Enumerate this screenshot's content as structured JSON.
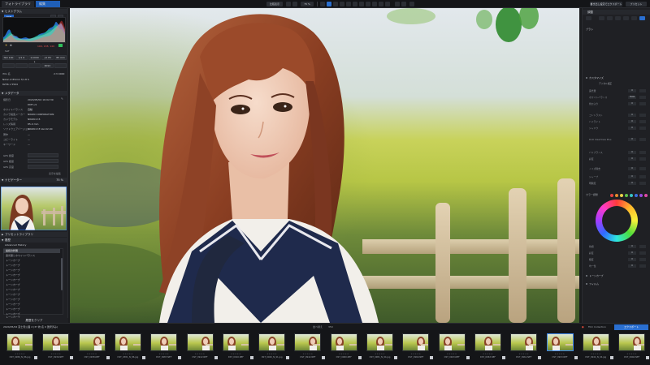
{
  "topbar": {
    "tab_library": "フォトライブラリ",
    "tab_edit": "編集",
    "compare_label": "比較表示",
    "zoom_label": "75 %",
    "export_label": "書き出し設定でエクスポート",
    "sync_label": "同期",
    "share_label": "プリセット"
  },
  "left": {
    "histogram_title": "ヒストグラム",
    "histo_badge": "RGB",
    "histo_values": "100, 138, 140",
    "camera_label": "SAT",
    "exif_boxes": [
      "ISO 100",
      "1/1 6",
      "1/1000 s",
      "+0 EV",
      "85 mm"
    ],
    "mode_label": "PASV",
    "lens_label": "Nikon Z 85mm f/1.8 S",
    "res_label": "8256 x 5504",
    "image_label": "IMG 名",
    "image_value": "2:3 0000",
    "metadata_title": "メタデータ",
    "meta_rows": [
      {
        "label": "撮影日",
        "value": "2024/05/02 16:02:39"
      },
      {
        "label": "",
        "value": "DMT+9"
      },
      {
        "label": "ホワイトバランス",
        "value": "自動"
      },
      {
        "label": "カメラ製造メーカー",
        "value": "NIKON CORPORATION"
      },
      {
        "label": "カメラモデル",
        "value": "NIKON Z 8"
      },
      {
        "label": "レンズ情報",
        "value": "85.0 mm"
      },
      {
        "label": "ソフトウェアバージョン",
        "value": "NIKON Z 8 Ver.02.00"
      },
      {
        "label": "著作",
        "value": "—"
      },
      {
        "label": "コピーライト",
        "value": "—"
      },
      {
        "label": "キーワード",
        "value": "—"
      },
      {
        "label": "GPS 緯度",
        "value": ""
      },
      {
        "label": "GPS 経度",
        "value": ""
      },
      {
        "label": "GPS 高度",
        "value": ""
      }
    ],
    "apply_label": "表示を編集",
    "navigator_title": "ナビゲーター",
    "nav_zoom": "75 %",
    "preset_title": "プリセットライブラリ",
    "history_title": "履歴",
    "history_subtitle": "Advanced History",
    "history_items": [
      "最初の状態",
      "露光量とホワイトバランス",
      "トーンカーブ",
      "トーンカーブ",
      "トーンカーブ",
      "トーンカーブ",
      "トーンカーブ",
      "トーンカーブ",
      "トーンカーブ",
      "トーンカーブ",
      "トーンカーブ",
      "トーンカーブ",
      "トーンカーブ",
      "トーンカーブ",
      "トーンカーブ"
    ],
    "footer_label": "履歴をクリア"
  },
  "right": {
    "header_label": "調整",
    "tool_label": "ブラシ",
    "section_title": "カスタマイズ",
    "section_sub": "デジタル補正",
    "rows": [
      {
        "label": "露光量",
        "value": "0"
      },
      {
        "label": "ホワイトバランス",
        "value": "5500"
      },
      {
        "label": "色かぶり",
        "value": "0"
      },
      {
        "label": "コントラスト",
        "value": "0"
      },
      {
        "label": "ハイライト",
        "value": "0"
      },
      {
        "label": "シャドウ",
        "value": "0"
      },
      {
        "label": "DxO ClearView Plus",
        "value": "0"
      },
      {
        "label": "バイブランス",
        "value": "0"
      },
      {
        "label": "彩度",
        "value": "0"
      },
      {
        "label": "ノイズ除去",
        "value": "0"
      },
      {
        "label": "シャープ",
        "value": "0"
      },
      {
        "label": "明瞭度",
        "value": "0"
      }
    ],
    "color_label": "カラー調整",
    "hsl_rows": [
      {
        "label": "色相",
        "value": "0"
      },
      {
        "label": "彩度",
        "value": "0"
      },
      {
        "label": "輝度",
        "value": "0"
      },
      {
        "label": "均一性",
        "value": "0"
      }
    ],
    "bottom_sections": [
      "トーンカーブ",
      "フィルム"
    ],
    "swatch_colors": [
      "#e84242",
      "#e88a2c",
      "#e8d24a",
      "#5ec24a",
      "#38c4c4",
      "#3a6de0",
      "#9a4ae0",
      "#e04aa8"
    ]
  },
  "filmbar": {
    "path_label": "2024/05/02 富士見公園 2 (37 枚 名 0 選択済み)",
    "sort_label": "並べ替え",
    "count_label": "350",
    "collection_label": "Film Collection",
    "export_button": "エクスポート"
  },
  "filmstrip": {
    "items": [
      "DST_0286_N_86.jpg",
      "DST_0936.NEF",
      "DST_0938.NEF",
      "DST_0381_N_86.jpg",
      "DST_0987.NEF",
      "DST_0942.NEF",
      "DST_0910.NEF",
      "DST_0940_N_91.jpg",
      "DST_0942.NEF",
      "DST_0960.NEF",
      "DST_0981_N_94.jpg",
      "DST_0960.NEF",
      "DST_0943.NEF",
      "DST_0963.NEF",
      "DST_0961.NEF",
      "DST_0993.NEF",
      "DST_0944_N_94.jpg",
      "DST_0946.NEF"
    ],
    "stars": "★★★★★"
  }
}
